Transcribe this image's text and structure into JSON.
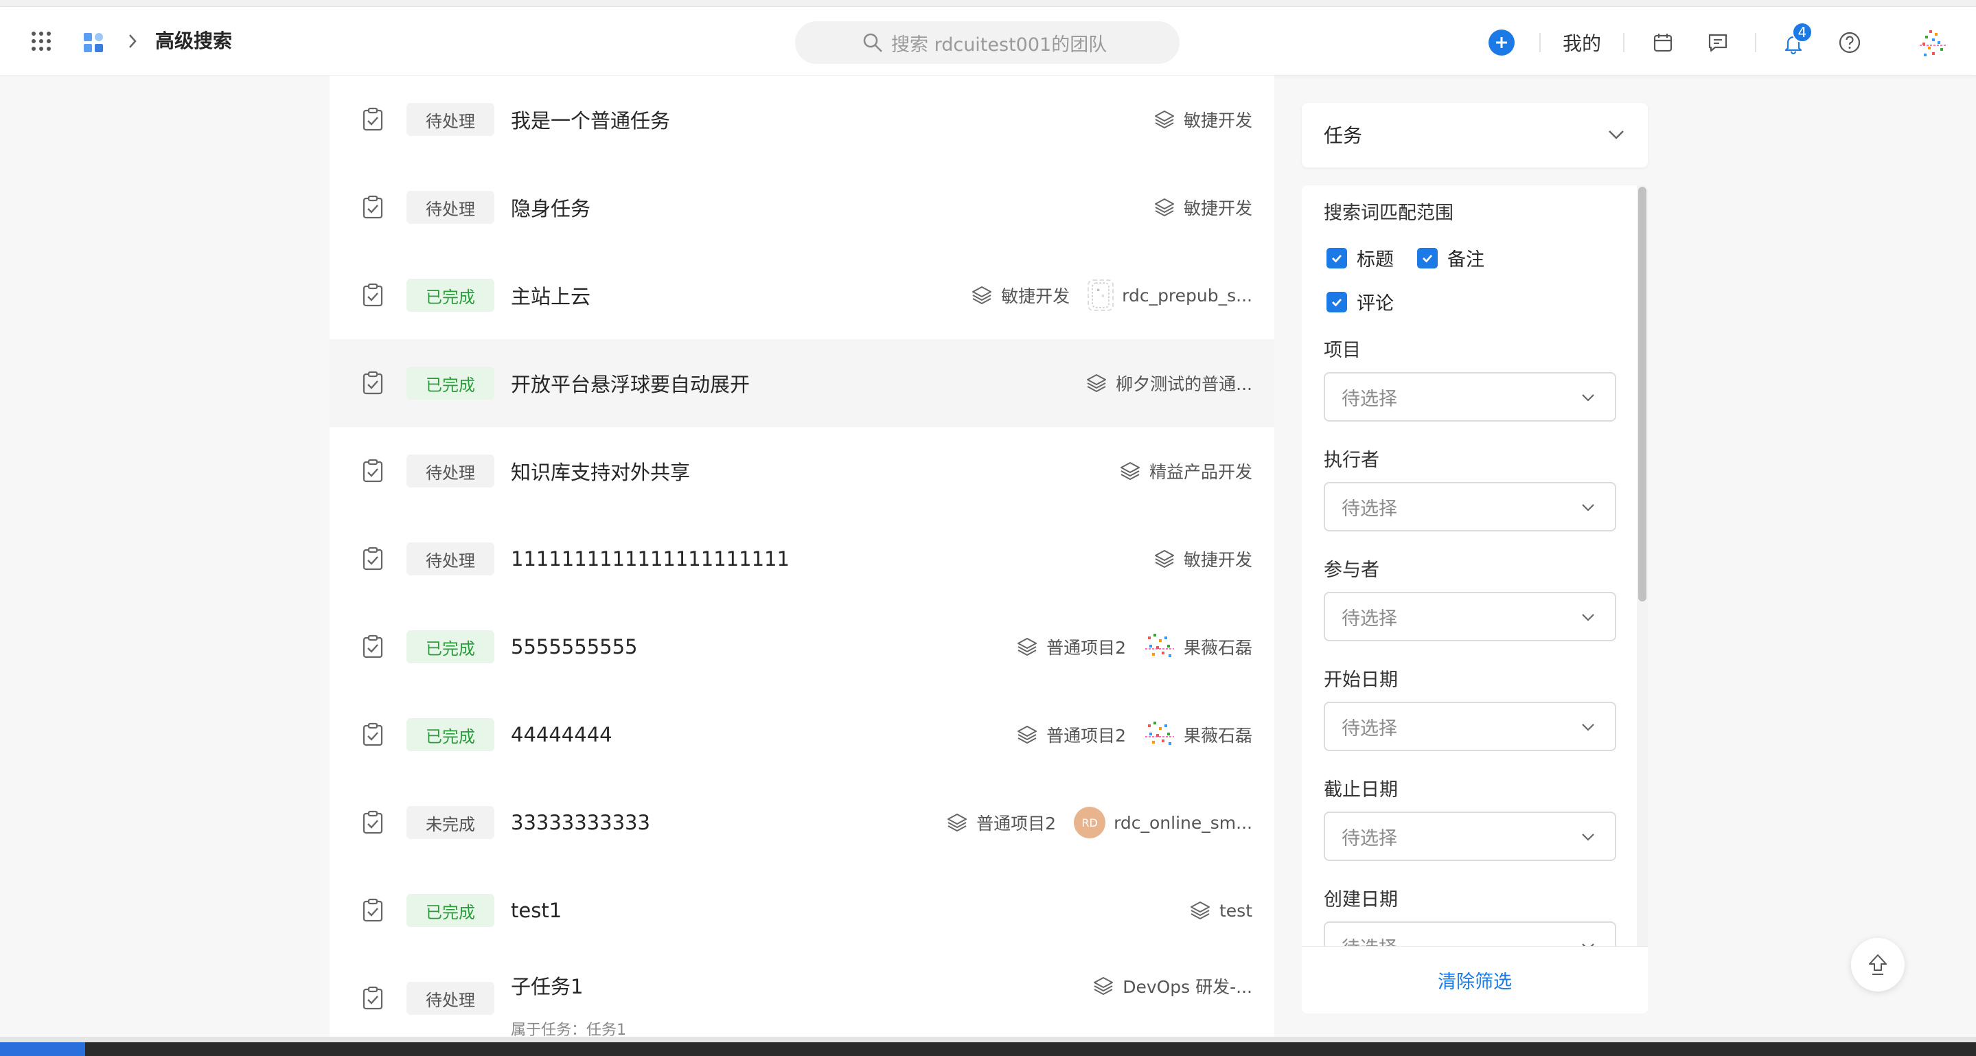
{
  "header": {
    "page_title": "高级搜索",
    "search_placeholder": "搜索 rdcuitest001的团队",
    "mine_label": "我的",
    "notification_count": "4"
  },
  "tasks": [
    {
      "status": "待处理",
      "status_kind": "pending",
      "title": "我是一个普通任务",
      "project": "敏捷开发",
      "assignee": ""
    },
    {
      "status": "待处理",
      "status_kind": "pending",
      "title": "隐身任务",
      "project": "敏捷开发",
      "assignee": ""
    },
    {
      "status": "已完成",
      "status_kind": "done",
      "title": "主站上云",
      "project": "敏捷开发",
      "assignee": "rdc_prepub_s..."
    },
    {
      "status": "已完成",
      "status_kind": "done",
      "title": "开放平台悬浮球要自动展开",
      "project": "柳夕测试的普通...",
      "assignee": ""
    },
    {
      "status": "待处理",
      "status_kind": "pending",
      "title": "知识库支持对外共享",
      "project": "精益产品开发",
      "assignee": ""
    },
    {
      "status": "待处理",
      "status_kind": "pending",
      "title": "1111111111111111111111",
      "project": "敏捷开发",
      "assignee": ""
    },
    {
      "status": "已完成",
      "status_kind": "done",
      "title": "5555555555",
      "project": "普通项目2",
      "assignee": "果薇石磊"
    },
    {
      "status": "已完成",
      "status_kind": "done",
      "title": "44444444",
      "project": "普通项目2",
      "assignee": "果薇石磊"
    },
    {
      "status": "未完成",
      "status_kind": "undone",
      "title": "33333333333",
      "project": "普通项目2",
      "assignee": "rdc_online_sm...",
      "avatar_text": "RD"
    },
    {
      "status": "已完成",
      "status_kind": "done",
      "title": "test1",
      "project": "test",
      "assignee": ""
    },
    {
      "status": "待处理",
      "status_kind": "pending",
      "title": "子任务1",
      "project": "DevOps 研发-...",
      "assignee": "",
      "note": "属于任务：任务1"
    }
  ],
  "filter": {
    "type_label": "任务",
    "match_scope_label": "搜索词匹配范围",
    "checkboxes": [
      "标题",
      "备注",
      "评论"
    ],
    "fields": [
      {
        "label": "项目",
        "placeholder": "待选择"
      },
      {
        "label": "执行者",
        "placeholder": "待选择"
      },
      {
        "label": "参与者",
        "placeholder": "待选择"
      },
      {
        "label": "开始日期",
        "placeholder": "待选择"
      },
      {
        "label": "截止日期",
        "placeholder": "待选择"
      },
      {
        "label": "创建日期",
        "placeholder": "待选择"
      }
    ],
    "clear_label": "清除筛选"
  },
  "colors": {
    "accent": "#1b7ae6",
    "done_text": "#2a9d3a",
    "done_bg": "#e7f6e9"
  }
}
